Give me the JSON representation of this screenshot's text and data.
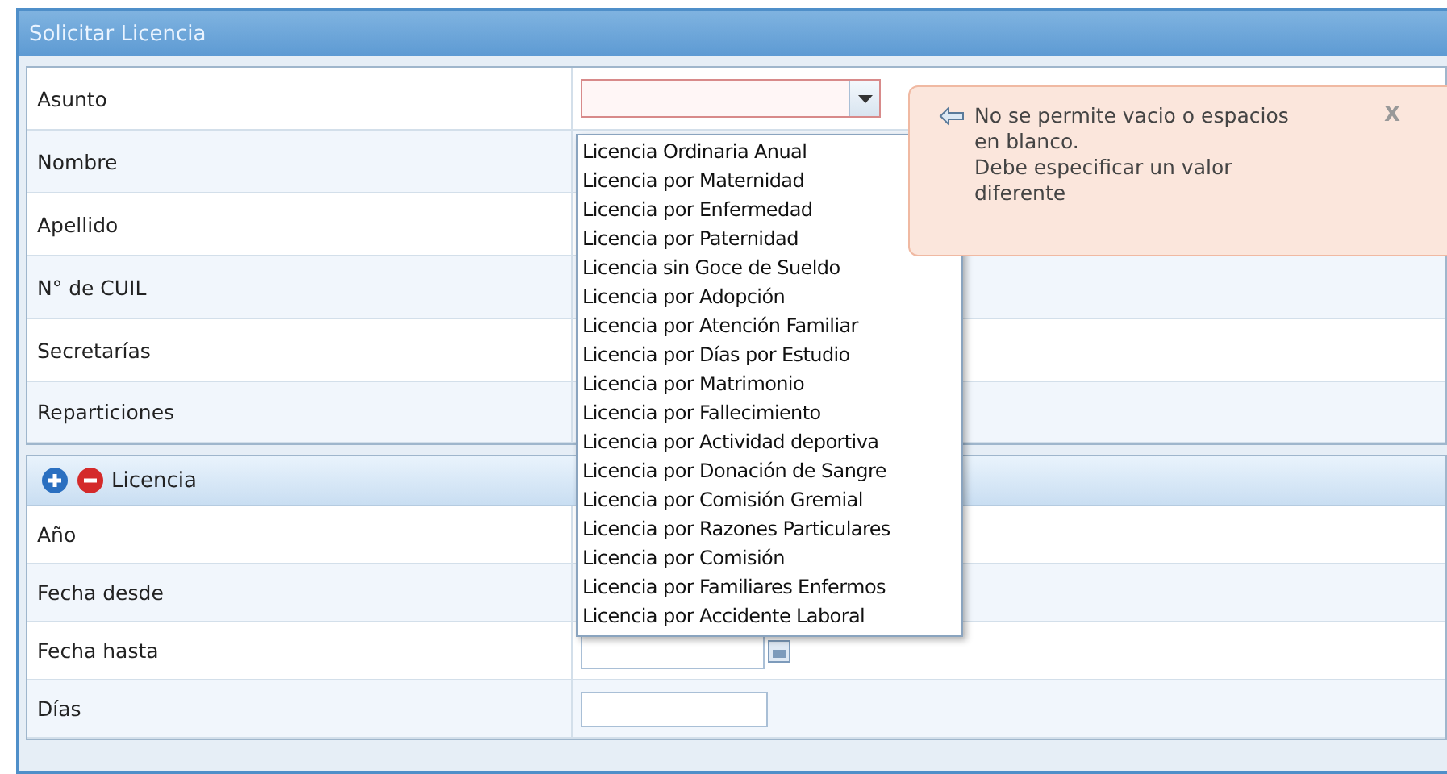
{
  "window": {
    "title": "Solicitar Licencia"
  },
  "personal_rows": [
    {
      "label": "Asunto",
      "field": {
        "kind": "select",
        "error": true
      }
    },
    {
      "label": "Nombre"
    },
    {
      "label": "Apellido"
    },
    {
      "label": "N° de CUIL"
    },
    {
      "label": "Secretarías"
    },
    {
      "label": "Reparticiones"
    }
  ],
  "section": {
    "title": "Licencia"
  },
  "license_rows": [
    {
      "label": "Año"
    },
    {
      "label": "Fecha desde"
    },
    {
      "label": "Fecha hasta",
      "field": {
        "kind": "date"
      }
    },
    {
      "label": "Días",
      "field": {
        "kind": "text"
      }
    }
  ],
  "dropdown": {
    "options": [
      "Licencia Ordinaria Anual",
      "Licencia por Maternidad",
      "Licencia por Enfermedad",
      "Licencia por Paternidad",
      "Licencia sin Goce de Sueldo",
      "Licencia por Adopción",
      "Licencia por Atención Familiar",
      "Licencia por Días por Estudio",
      "Licencia por Matrimonio",
      "Licencia por Fallecimiento",
      "Licencia por Actividad deportiva",
      "Licencia por Donación de Sangre",
      "Licencia por Comisión Gremial",
      "Licencia por Razones Particulares",
      "Licencia por Comisión",
      "Licencia por Familiares Enfermos",
      "Licencia por Accidente Laboral"
    ]
  },
  "error_tooltip": {
    "lines": [
      "No se permite vacio o espacios en blanco.",
      "Debe especificar un valor diferente"
    ],
    "close": "X"
  }
}
